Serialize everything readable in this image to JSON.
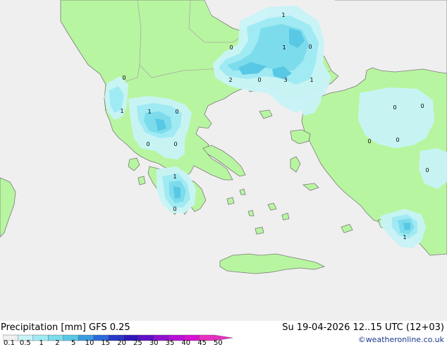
{
  "title": "Precipitation [mm]  GFS 0.25",
  "timestamp": "Su 19-04-2026 12..15 UTC (12+03)",
  "credit": "©weatheronline.co.uk",
  "legend": {
    "ticks": [
      "0.1",
      "0.5",
      "1",
      "2",
      "5",
      "10",
      "15",
      "20",
      "25",
      "30",
      "35",
      "40",
      "45",
      "50"
    ],
    "colors": [
      "#f0f0f0",
      "#c8f4f8",
      "#a0eaf4",
      "#7cdcec",
      "#58c8e4",
      "#3a9ce0",
      "#2c6ad8",
      "#2838c8",
      "#3018b8",
      "#6010c8",
      "#9010d0",
      "#b810d8",
      "#d810d0",
      "#e830c0"
    ]
  },
  "colors": {
    "sea": "#efefef",
    "land": "#b8f5a0",
    "border": "#b0b0b0",
    "coast": "#707070"
  },
  "contour_labels": [
    "1",
    "0",
    "1",
    "0",
    "2",
    "0",
    "3",
    "1",
    "0",
    "1",
    "1",
    "0",
    "0",
    "0",
    "0",
    "0",
    "0",
    "1",
    "0",
    "1",
    "0",
    "0"
  ]
}
